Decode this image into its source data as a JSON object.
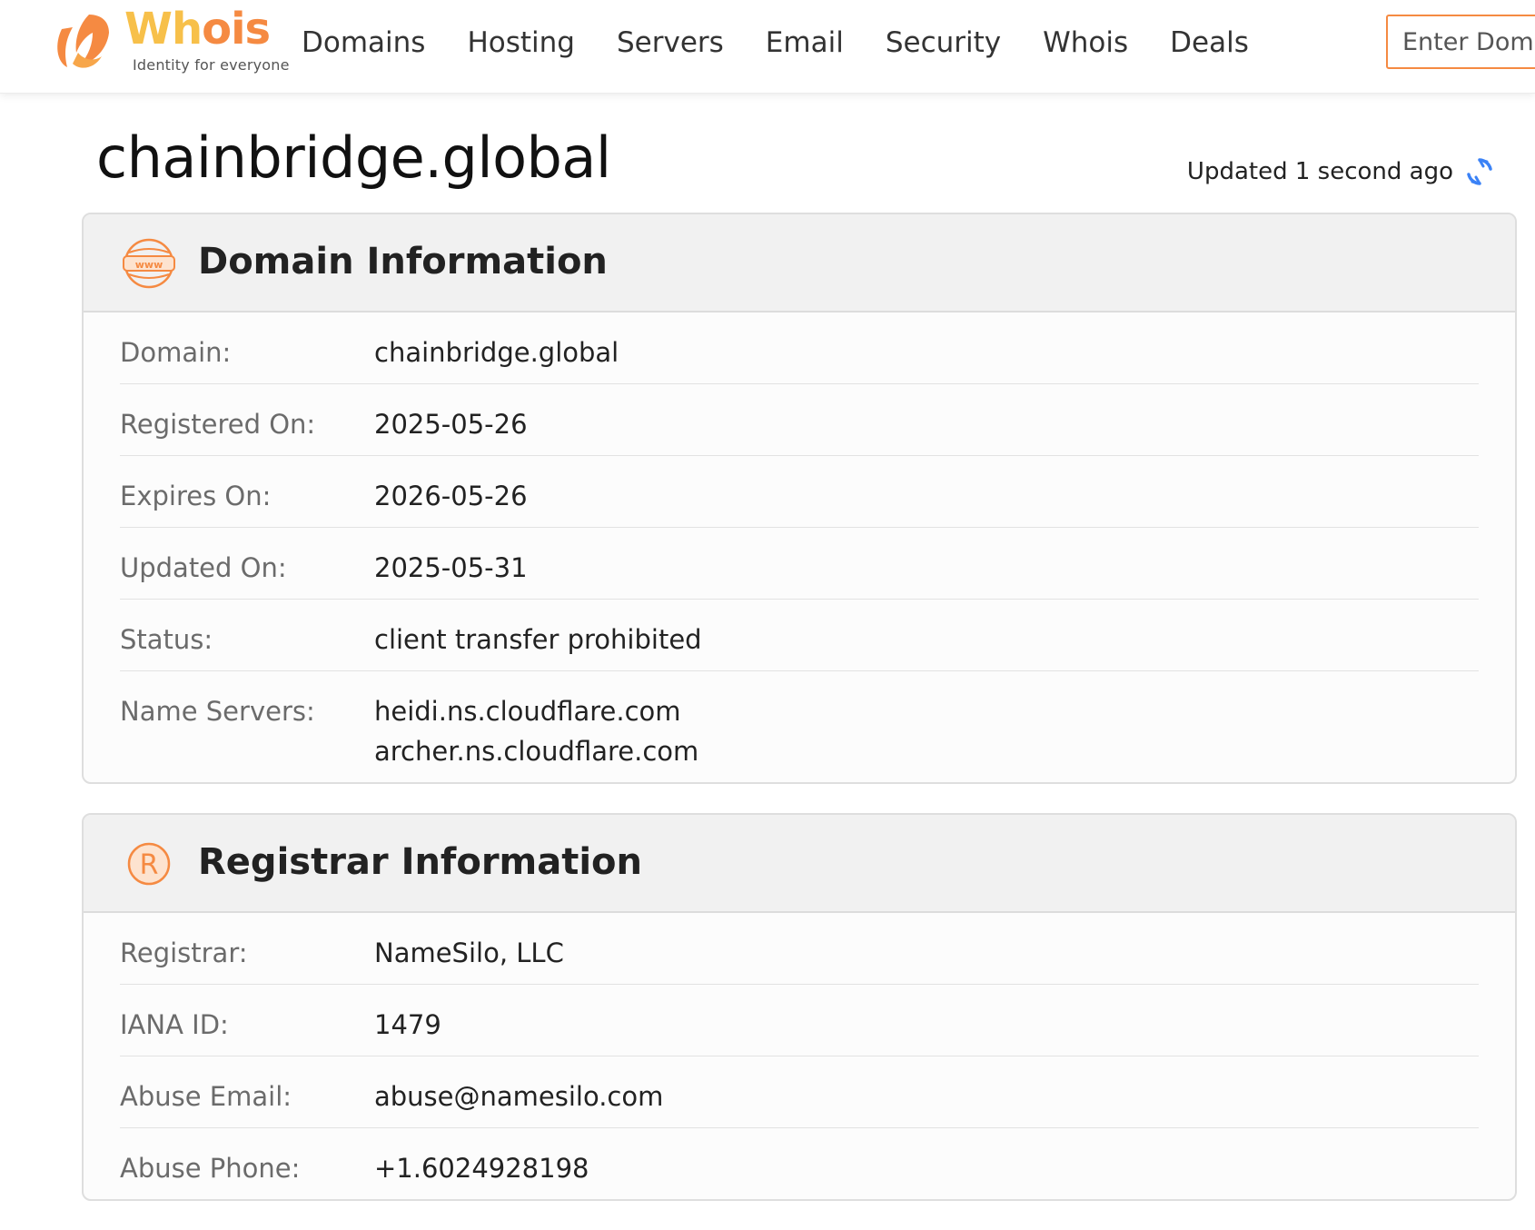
{
  "brand": {
    "word_part1": "Wh",
    "word_part2": "ois",
    "tagline": "Identity for everyone",
    "color_primary": "#f58a42",
    "color_secondary": "#f7c04a"
  },
  "nav": {
    "items": [
      "Domains",
      "Hosting",
      "Servers",
      "Email",
      "Security",
      "Whois",
      "Deals"
    ]
  },
  "search": {
    "placeholder": "Enter Domain"
  },
  "page": {
    "title": "chainbridge.global",
    "updated_text": "Updated 1 second ago",
    "refresh_icon": "refresh-icon",
    "refresh_color": "#3b82f6"
  },
  "domain_info": {
    "title": "Domain Information",
    "icon": "www-globe-icon",
    "rows": [
      {
        "label": "Domain:",
        "value": "chainbridge.global"
      },
      {
        "label": "Registered On:",
        "value": "2025-05-26"
      },
      {
        "label": "Expires On:",
        "value": "2026-05-26"
      },
      {
        "label": "Updated On:",
        "value": "2025-05-31"
      },
      {
        "label": "Status:",
        "value": "client transfer prohibited"
      },
      {
        "label": "Name Servers:",
        "values": [
          "heidi.ns.cloudflare.com",
          "archer.ns.cloudflare.com"
        ]
      }
    ]
  },
  "registrar_info": {
    "title": "Registrar Information",
    "icon": "registered-trademark-icon",
    "rows": [
      {
        "label": "Registrar:",
        "value": "NameSilo, LLC"
      },
      {
        "label": "IANA ID:",
        "value": "1479"
      },
      {
        "label": "Abuse Email:",
        "value": "abuse@namesilo.com"
      },
      {
        "label": "Abuse Phone:",
        "value": "+1.6024928198"
      }
    ]
  }
}
